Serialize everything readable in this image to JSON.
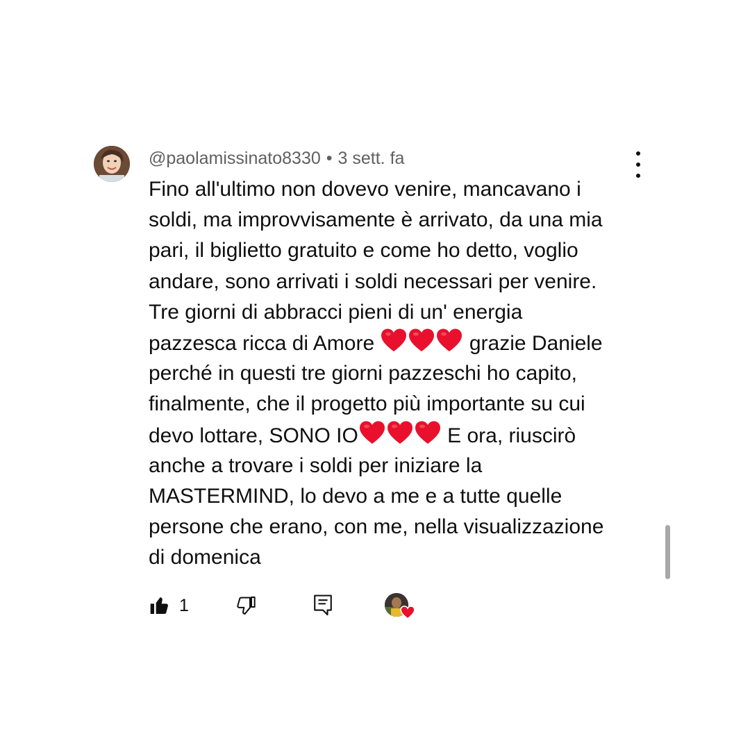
{
  "comment": {
    "author": "@paolamissinato8330",
    "separator": "•",
    "time": "3 sett. fa",
    "lines": [
      "Fino all'ultimo non dovevo venire, mancavano i",
      "soldi, ma improvvisamente è arrivato, da una mia",
      "pari, il biglietto gratuito e come ho detto, voglio",
      "andare, sono arrivati i soldi necessari per venire.",
      "Tre giorni di abbracci pieni di un' energia",
      "pazzesca ricca di Amore",
      "grazie Daniele",
      "perché in questi tre giorni pazzeschi ho capito,",
      "finalmente, che il progetto più importante su cui",
      "devo lottare, SONO IO",
      "E ora, riuscirò",
      "anche a trovare i soldi per iniziare la",
      "MASTERMIND, lo devo a me e a tutte quelle",
      "persone che erano, con me, nella visualizzazione",
      "di domenica"
    ]
  },
  "actions": {
    "like_count": "1",
    "like_icon": "thumb-up-filled-icon",
    "dislike_icon": "thumb-down-outline-icon",
    "reply_icon": "reply-comment-icon",
    "creator_heart_icon": "creator-heart-badge"
  },
  "menu_icon": "more-vertical-icon",
  "colors": {
    "text": "#0f0f0f",
    "meta": "#606060",
    "heart": "#e8102c",
    "scrollbar": "#a8a8a8"
  }
}
